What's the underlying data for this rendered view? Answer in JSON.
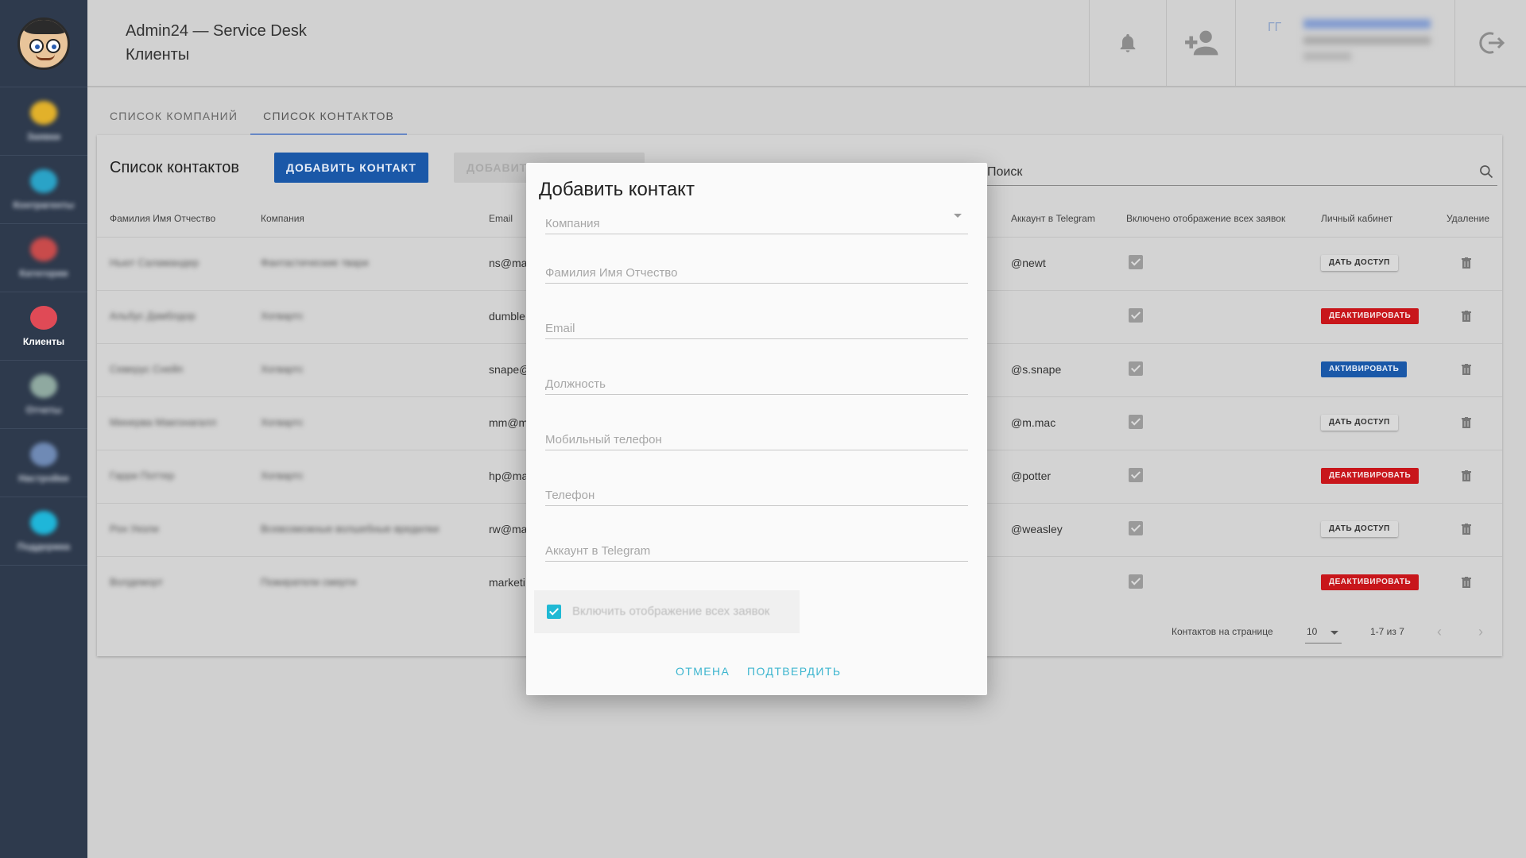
{
  "header": {
    "app_title": "Admin24 — Service Desk",
    "page_title": "Клиенты"
  },
  "sidebar": {
    "items": [
      {
        "label": "Заявки",
        "icon": "tickets-icon",
        "color": "#e2b12a",
        "active": false
      },
      {
        "label": "Контрагенты",
        "icon": "globe-icon",
        "color": "#2aa3c7",
        "active": false
      },
      {
        "label": "Категории",
        "icon": "categories-icon",
        "color": "#c94b4b",
        "active": false
      },
      {
        "label": "Клиенты",
        "icon": "clients-icon",
        "color": "#e04a56",
        "active": true
      },
      {
        "label": "Отчеты",
        "icon": "reports-icon",
        "color": "#8fa9a0",
        "active": false
      },
      {
        "label": "Настройки",
        "icon": "settings-icon",
        "color": "#6f8ab5",
        "active": false
      },
      {
        "label": "Поддержка",
        "icon": "support-icon",
        "color": "#1fb6d9",
        "active": false
      }
    ]
  },
  "tabs": [
    "СПИСОК КОМПАНИЙ",
    "СПИСОК КОНТАКТОВ"
  ],
  "main": {
    "title": "Список контактов",
    "add_contact_btn": "ДОБАВИТЬ КОНТАКТ",
    "add_btn2": "ДОБАВИТ",
    "search_placeholder": "Поиск"
  },
  "table": {
    "columns": [
      "Фамилия Имя Отчество",
      "Компания",
      "Email",
      "Аккаунт в Telegram",
      "Включено отображение всех заявок",
      "Личный кабинет",
      "Удаление"
    ],
    "rows": [
      {
        "name": "Ньют Саламандер",
        "company": "Фантастические твари",
        "email": "ns@ma",
        "telegram": "@newt",
        "action": "ДАТЬ ДОСТУП",
        "action_type": "grant"
      },
      {
        "name": "Альбус Дамблдор",
        "company": "Хогвартс",
        "email": "dumble",
        "telegram": "",
        "action": "ДЕАКТИВИРОВАТЬ",
        "action_type": "deact"
      },
      {
        "name": "Северус Снейп",
        "company": "Хогвартс",
        "email": "snape@",
        "telegram": "@s.snape",
        "action": "АКТИВИРОВАТЬ",
        "action_type": "act"
      },
      {
        "name": "Минерва Макгонагалл",
        "company": "Хогвартс",
        "email": "mm@m",
        "telegram": "@m.mac",
        "action": "ДАТЬ ДОСТУП",
        "action_type": "grant"
      },
      {
        "name": "Гарри Поттер",
        "company": "Хогвартс",
        "email": "hp@ma",
        "telegram": "@potter",
        "action": "ДЕАКТИВИРОВАТЬ",
        "action_type": "deact"
      },
      {
        "name": "Рон Уизли",
        "company": "Всевозможные волшебные вредилки",
        "email": "rw@ma",
        "telegram": "@weasley",
        "action": "ДАТЬ ДОСТУП",
        "action_type": "grant"
      },
      {
        "name": "Волдеморт",
        "company": "Пожиратели смерти",
        "email": "marketi",
        "telegram": "",
        "action": "ДЕАКТИВИРОВАТЬ",
        "action_type": "deact"
      }
    ]
  },
  "pager": {
    "per_page_label": "Контактов на странице",
    "per_page_value": "10",
    "range": "1-7 из 7"
  },
  "dialog": {
    "title": "Добавить контакт",
    "fields": [
      {
        "placeholder": "Компания",
        "value": ""
      },
      {
        "placeholder": "Фамилия Имя Отчество",
        "value": ""
      },
      {
        "placeholder": "Email",
        "value": ""
      },
      {
        "placeholder": "Должность",
        "value": ""
      },
      {
        "placeholder": "Мобильный телефон",
        "value": ""
      },
      {
        "placeholder": "Телефон",
        "value": ""
      },
      {
        "placeholder": "Аккаунт в Telegram",
        "value": ""
      }
    ],
    "checkbox_label": "Включить отображение всех заявок",
    "cancel": "ОТМЕНА",
    "confirm": "ПОДТВЕРДИТЬ"
  },
  "user": {
    "initials": "ГГ"
  },
  "colors": {
    "sidebar": "#2e3a4d",
    "primary": "#1a58a8",
    "danger": "#c8161b",
    "accent": "#3cb5cf"
  }
}
